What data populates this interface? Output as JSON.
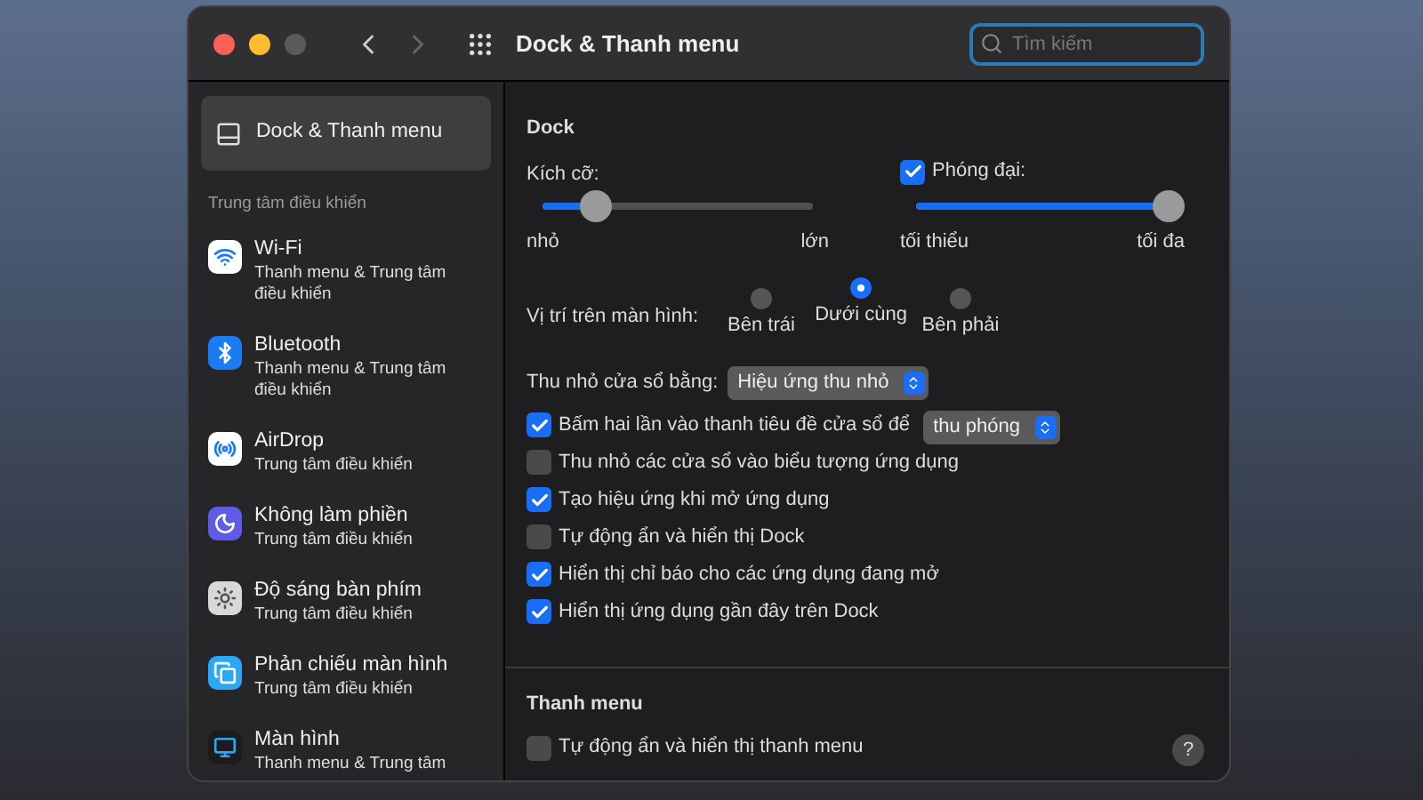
{
  "window": {
    "title": "Dock & Thanh menu",
    "search": {
      "placeholder": "Tìm kiếm"
    }
  },
  "sidebar": {
    "top_item": {
      "label": "Dock & Thanh menu",
      "selected": true
    },
    "section_title": "Trung tâm điều khiển",
    "items": [
      {
        "kind": "wifi",
        "label": "Wi-Fi",
        "subtitle": "Thanh menu & Trung tâm điều khiển",
        "selected": false
      },
      {
        "kind": "bluetooth",
        "label": "Bluetooth",
        "subtitle": "Thanh menu & Trung tâm điều khiển",
        "selected": false
      },
      {
        "kind": "airdrop",
        "label": "AirDrop",
        "subtitle": "Trung tâm điều khiển",
        "selected": false
      },
      {
        "kind": "moon",
        "label": "Không làm phiền",
        "subtitle": "Trung tâm điều khiển",
        "selected": false
      },
      {
        "kind": "brightness",
        "label": "Độ sáng bàn phím",
        "subtitle": "Trung tâm điều khiển",
        "selected": false
      },
      {
        "kind": "mirror",
        "label": "Phản chiếu màn hình",
        "subtitle": "Trung tâm điều khiển",
        "selected": false
      },
      {
        "kind": "display",
        "label": "Màn hình",
        "subtitle": "Thanh menu & Trung tâm",
        "selected": false
      }
    ]
  },
  "dock": {
    "title": "Dock",
    "size": {
      "label": "Kích cỡ:",
      "level": 0.2,
      "min_label": "nhỏ",
      "max_label": "lớn"
    },
    "magnification": {
      "label": "Phóng đại:",
      "checked": true,
      "level": 1,
      "min_label": "tối thiểu",
      "max_label": "tối đa"
    },
    "position": {
      "label": "Vị trí trên màn hình:",
      "options": [
        {
          "label": "Bên trái",
          "selected": false
        },
        {
          "label": "Dưới cùng",
          "selected": true
        },
        {
          "label": "Bên phải",
          "selected": false
        }
      ]
    },
    "minimize": {
      "label": "Thu nhỏ cửa sổ bằng:",
      "value": "Hiệu ứng thu nhỏ"
    },
    "options": [
      {
        "label": "Bấm hai lần vào thanh tiêu đề cửa sổ để",
        "checked": true,
        "select": "thu phóng"
      },
      {
        "label": "Thu nhỏ các cửa sổ vào biểu tượng ứng dụng",
        "checked": false
      },
      {
        "label": "Tạo hiệu ứng khi mở ứng dụng",
        "checked": true
      },
      {
        "label": "Tự động ẩn và hiển thị Dock",
        "checked": false
      },
      {
        "label": "Hiển thị chỉ báo cho các ứng dụng đang mở",
        "checked": true
      },
      {
        "label": "Hiển thị ứng dụng gần đây trên Dock",
        "checked": true
      }
    ]
  },
  "menu_bar": {
    "title": "Thanh menu",
    "options": [
      {
        "label": "Tự động ẩn và hiển thị thanh menu",
        "checked": false
      }
    ]
  },
  "help_button": "?"
}
